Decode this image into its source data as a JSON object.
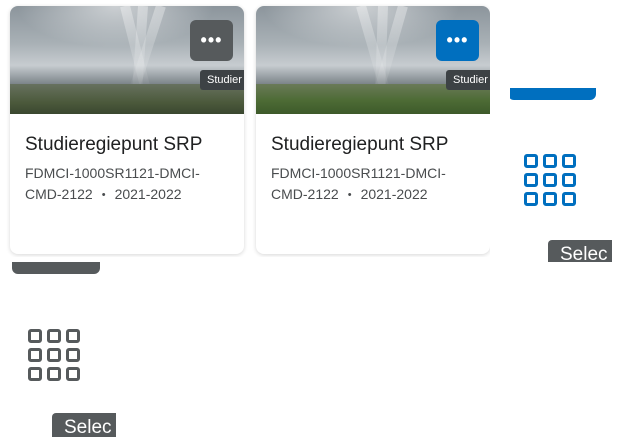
{
  "cards": [
    {
      "title": "Studieregiepunt SRP",
      "code": "FDMCI-1000SR1121-DMCI-CMD-2122",
      "year": "2021-2022",
      "image_label": "Studier",
      "more_icon": "ellipsis-icon",
      "more_label": "•••",
      "more_color": "#565a5c"
    },
    {
      "title": "Studieregiepunt SRP",
      "code": "FDMCI-1000SR1121-DMCI-CMD-2122",
      "year": "2021-2022",
      "image_label": "Studier",
      "more_icon": "ellipsis-icon",
      "more_label": "•••",
      "more_color": "#006fbf"
    }
  ],
  "separator": "•",
  "tiles": [
    {
      "icon": "grid-icon",
      "color": "#006fbf",
      "label": "Selec"
    },
    {
      "icon": "grid-icon",
      "color": "#565a5c",
      "label": "Selec"
    }
  ],
  "colors": {
    "accent": "#006fbf",
    "neutral": "#565a5c"
  }
}
